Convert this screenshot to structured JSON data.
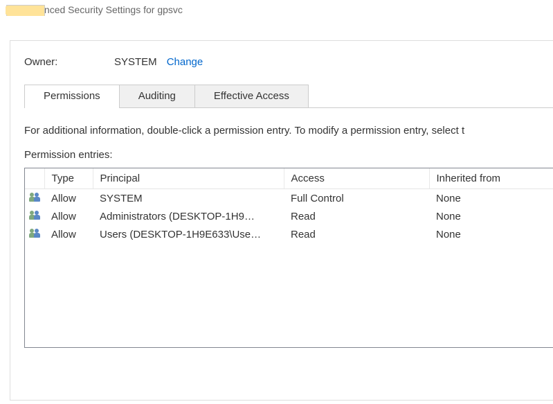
{
  "window": {
    "title": "Advanced Security Settings for gpsvc"
  },
  "owner": {
    "label": "Owner:",
    "value": "SYSTEM",
    "change_link": "Change"
  },
  "tabs": {
    "permissions": "Permissions",
    "auditing": "Auditing",
    "effective_access": "Effective Access",
    "active": "permissions"
  },
  "info_text": "For additional information, double-click a permission entry. To modify a permission entry, select t",
  "entries_label": "Permission entries:",
  "columns": {
    "type": "Type",
    "principal": "Principal",
    "access": "Access",
    "inherited": "Inherited from"
  },
  "entries": [
    {
      "type": "Allow",
      "principal": "SYSTEM",
      "access": "Full Control",
      "inherited": "None"
    },
    {
      "type": "Allow",
      "principal": "Administrators (DESKTOP-1H9…",
      "access": "Read",
      "inherited": "None"
    },
    {
      "type": "Allow",
      "principal": "Users (DESKTOP-1H9E633\\Use…",
      "access": "Read",
      "inherited": "None"
    }
  ]
}
